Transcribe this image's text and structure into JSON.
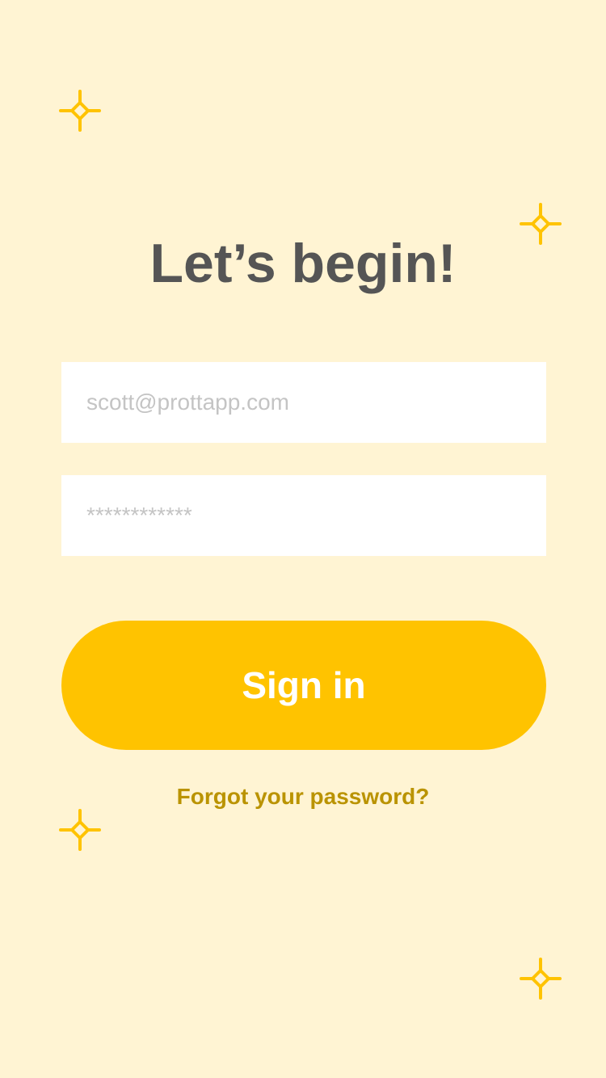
{
  "screen": {
    "background_color": "#FFF4D3",
    "accent_color": "#FFC300",
    "link_color": "#BA9300",
    "title_color": "#555555"
  },
  "title": "Let’s begin!",
  "email_field": {
    "placeholder": "scott@prottapp.com"
  },
  "password_field": {
    "placeholder": "************"
  },
  "sign_in_button": {
    "label": "Sign in"
  },
  "forgot_link": {
    "label": "Forgot your password?"
  },
  "decorations": {
    "icon": "sparkle-icon"
  }
}
